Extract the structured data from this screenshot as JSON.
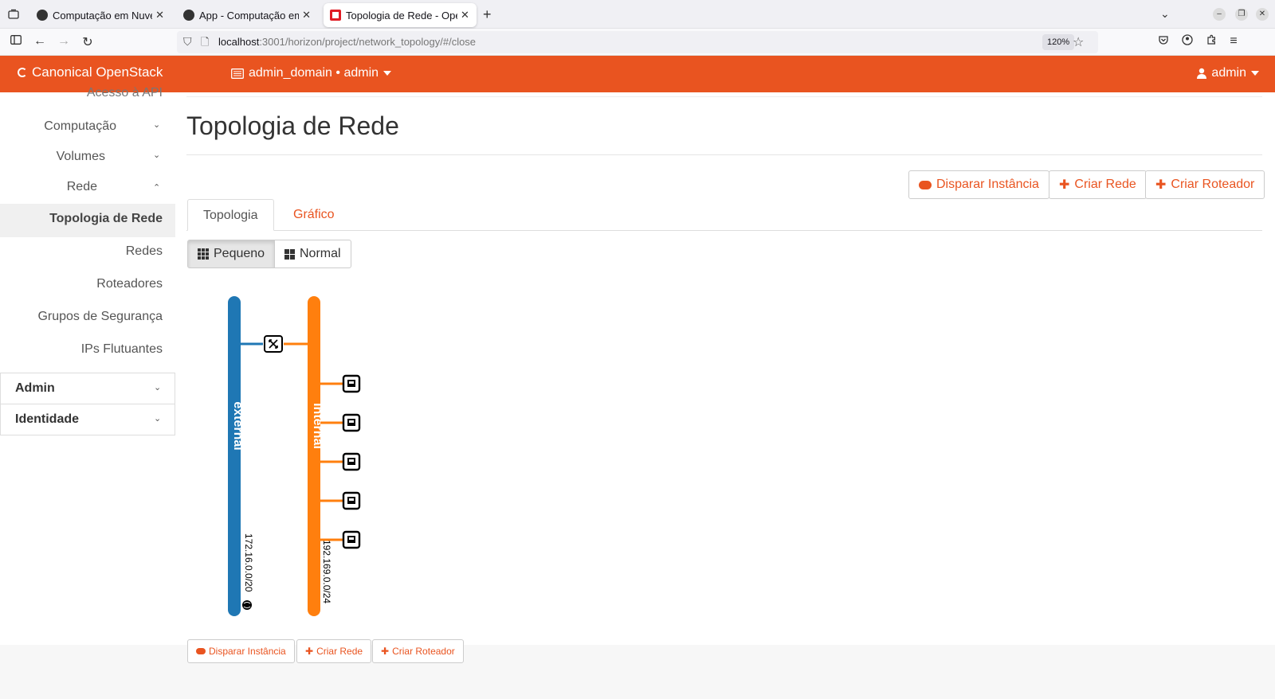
{
  "browser": {
    "tabs": [
      {
        "title": "Computação em Nuvem -",
        "active": false
      },
      {
        "title": "App - Computação em Nu",
        "active": false
      },
      {
        "title": "Topologia de Rede - Oper",
        "active": true
      }
    ],
    "url_host": "localhost",
    "url_rest": ":3001/horizon/project/network_topology/#/close",
    "zoom": "120%"
  },
  "header": {
    "brand": "Canonical OpenStack",
    "project": "admin_domain • admin",
    "user": "admin",
    "accent": "#e95420"
  },
  "sidebar": {
    "partial_item": "Acesso à API",
    "groups": [
      {
        "label": "Computação",
        "expanded": false
      },
      {
        "label": "Volumes",
        "expanded": false
      },
      {
        "label": "Rede",
        "expanded": true
      }
    ],
    "rede_items": [
      {
        "label": "Topologia de Rede",
        "active": true
      },
      {
        "label": "Redes",
        "active": false
      },
      {
        "label": "Roteadores",
        "active": false
      },
      {
        "label": "Grupos de Segurança",
        "active": false
      },
      {
        "label": "IPs Flutuantes",
        "active": false
      }
    ],
    "sections": [
      {
        "label": "Admin"
      },
      {
        "label": "Identidade"
      }
    ]
  },
  "page": {
    "title": "Topologia de Rede",
    "actions": {
      "launch_instance": "Disparar Instância",
      "create_network": "Criar Rede",
      "create_router": "Criar Roteador"
    },
    "tabs": [
      "Topologia",
      "Gráfico"
    ],
    "size_toggle": {
      "small": "Pequeno",
      "normal": "Normal",
      "selected": "Pequeno"
    }
  },
  "topology": {
    "networks": [
      {
        "name": "external",
        "cidr": "172.16.0.0/20",
        "color": "#1f77b4"
      },
      {
        "name": "internal",
        "cidr": "192.169.0.0/24",
        "color": "#ff7f0e"
      }
    ],
    "routers": 1,
    "instances": 5
  }
}
